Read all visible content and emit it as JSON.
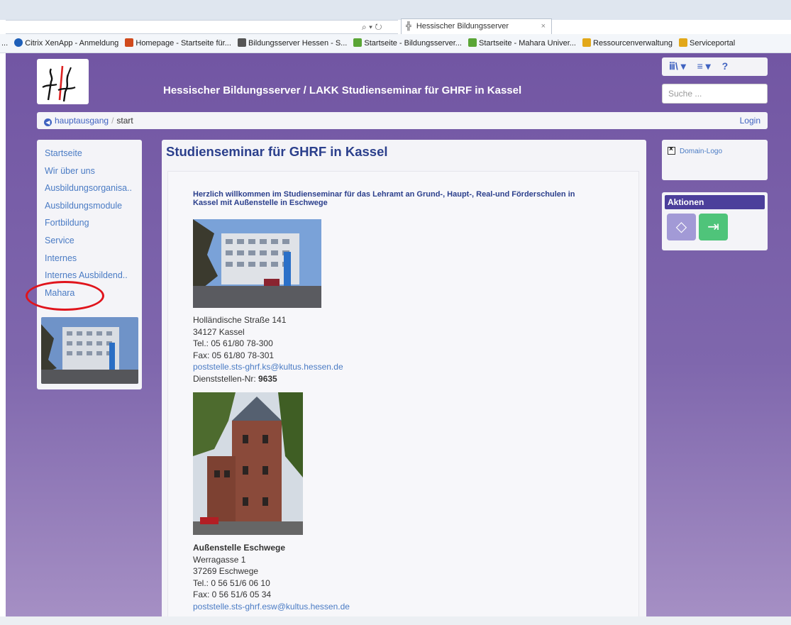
{
  "browser": {
    "address_icons": "⌕ ▾ ↻",
    "tab_title": "Hessischer Bildungsserver",
    "tab_close": "×",
    "favorites": [
      {
        "label": "Citrix XenApp - Anmeldung",
        "color": "#1e5fb8"
      },
      {
        "label": "Homepage - Startseite für...",
        "color": "#d04a1c"
      },
      {
        "label": "Bildungsserver Hessen - S...",
        "color": "#555555"
      },
      {
        "label": "Startseite - Bildungsserver...",
        "color": "#5aa536"
      },
      {
        "label": "Startseite - Mahara Univer...",
        "color": "#5aa536"
      },
      {
        "label": "Ressourcenverwaltung",
        "color": "#e2a81a"
      },
      {
        "label": "Serviceportal",
        "color": "#e2a81a"
      }
    ],
    "favorites_prefix": "..."
  },
  "header": {
    "site_title": "Hessischer Bildungsserver / LAKK Studienseminar für GHRF in Kassel",
    "toolbar": {
      "library": "ⅲ\\ ▾",
      "menu": "≡ ▾",
      "help": "?"
    },
    "search_placeholder": "Suche ..."
  },
  "breadcrumb": {
    "home_label": "hauptausgang",
    "separator": "/",
    "current": "start",
    "login": "Login"
  },
  "sidebar": {
    "items": [
      {
        "label": "Startseite"
      },
      {
        "label": "Wir über uns"
      },
      {
        "label": "Ausbildungsorganisa.."
      },
      {
        "label": "Ausbildungsmodule"
      },
      {
        "label": "Fortbildung"
      },
      {
        "label": "Service"
      },
      {
        "label": "Internes"
      },
      {
        "label": "Internes Ausbildend.."
      },
      {
        "label": "Mahara"
      }
    ]
  },
  "main": {
    "title": "Studienseminar für GHRF in Kassel",
    "welcome": "Herzlich willkommen im Studienseminar für das Lehramt an Grund-, Haupt-, Real-und Förderschulen in Kassel mit Außenstelle in Eschwege",
    "kassel": {
      "street": "Holländische Straße 141",
      "city": "34127 Kassel",
      "tel": "Tel.: 05 61/80 78-300",
      "fax": "Fax: 05 61/80 78-301",
      "email": "poststelle.sts-ghrf.ks@kultus.hessen.de",
      "office_label": "Dienststellen-Nr: ",
      "office_number": "9635"
    },
    "eschwege": {
      "heading": "Außenstelle Eschwege",
      "street": "Werragasse 1",
      "city": "37269 Eschwege",
      "tel": "Tel.: 0 56 51/6 06 10",
      "fax": "Fax: 0 56 51/6 05 34",
      "email": "poststelle.sts-ghrf.esw@kultus.hessen.de"
    }
  },
  "right": {
    "domain_logo": "Domain-Logo",
    "actions_title": "Aktionen"
  },
  "colors": {
    "page_purple": "#7256a3",
    "title_blue": "#2b3f8c",
    "link_blue": "#4a7bc4",
    "highlight_red": "#e0141c"
  }
}
